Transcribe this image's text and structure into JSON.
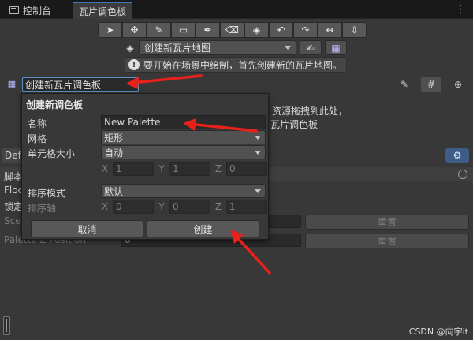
{
  "tabs": [
    {
      "label": "控制台",
      "active": false
    },
    {
      "label": "瓦片调色板",
      "active": true
    }
  ],
  "toolbar": {
    "tools": [
      {
        "name": "select-tool",
        "glyph": "➤"
      },
      {
        "name": "move-tool",
        "glyph": "✥"
      },
      {
        "name": "paint-brush-tool",
        "glyph": "✎"
      },
      {
        "name": "box-fill-tool",
        "glyph": "▭"
      },
      {
        "name": "picker-tool",
        "glyph": "✒"
      },
      {
        "name": "eraser-tool",
        "glyph": "⌫"
      },
      {
        "name": "fill-tool",
        "glyph": "◈"
      },
      {
        "name": "rotate-ccw-tool",
        "glyph": "↶"
      },
      {
        "name": "rotate-cw-tool",
        "glyph": "↷"
      },
      {
        "name": "flip-x-tool",
        "glyph": "⇹"
      },
      {
        "name": "flip-y-tool",
        "glyph": "⇳"
      }
    ]
  },
  "tilemap_dropdown": {
    "value": "创建新瓦片地图"
  },
  "help_message": "要开始在场景中绘制，首先创建新的瓦片地图。",
  "palette_dropdown": {
    "value": "创建新瓦片调色板"
  },
  "background_texts": {
    "drop_hint": "）资源拖拽到此处，",
    "palette_word": "瓦片调色板"
  },
  "lower": {
    "tab_label": "Default",
    "rows": [
      {
        "label": "脚本",
        "dim": false
      },
      {
        "label": "Floor",
        "dim": false
      },
      {
        "label": "锁定",
        "dim": false
      },
      {
        "label": "Scene",
        "dim": true
      },
      {
        "label": "Palette Z Position",
        "dim": true
      }
    ],
    "scene_field": "",
    "palette_z_value": "0",
    "reset_label": "重置"
  },
  "popup": {
    "title": "创建新调色板",
    "name_label": "名称",
    "name_value": "New Palette",
    "grid_label": "网格",
    "grid_value": "矩形",
    "cell_size_label": "单元格大小",
    "cell_size_value": "自动",
    "cell_xyz": {
      "x": "1",
      "y": "1",
      "z": "0"
    },
    "sort_mode_label": "排序模式",
    "sort_mode_value": "默认",
    "sort_axis_label": "排序轴",
    "sort_axis_xyz": {
      "x": "0",
      "y": "0",
      "z": "1"
    },
    "axis_letters": {
      "x": "X",
      "y": "Y",
      "z": "Z"
    },
    "cancel_label": "取消",
    "create_label": "创建"
  },
  "watermark": "CSDN @向宇it",
  "colors": {
    "arrow": "#e8211b",
    "accent_blue": "#3a79bb"
  }
}
